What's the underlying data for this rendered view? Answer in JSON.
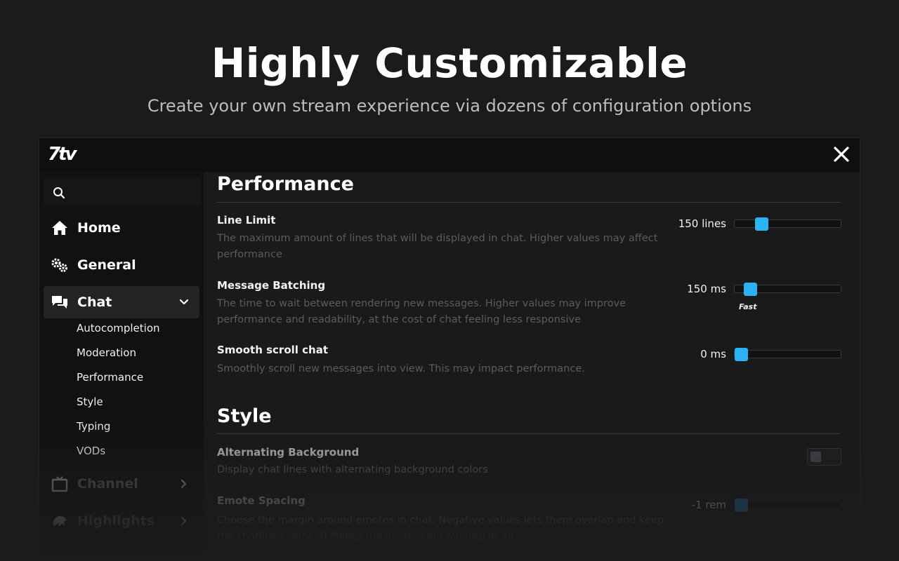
{
  "hero": {
    "title": "Highly Customizable",
    "subtitle": "Create your own stream experience via dozens of configuration options"
  },
  "window": {
    "logo": "7tv",
    "close_icon": "close-icon"
  },
  "sidebar": {
    "search_icon": "search-icon",
    "items": [
      {
        "label": "Home",
        "icon": "home-icon"
      },
      {
        "label": "General",
        "icon": "gears-icon"
      },
      {
        "label": "Chat",
        "icon": "chat-icon",
        "expanded": true
      },
      {
        "label": "Channel",
        "icon": "tv-icon"
      },
      {
        "label": "Highlights",
        "icon": "highlight-icon"
      }
    ],
    "chat_subitems": [
      "Autocompletion",
      "Moderation",
      "Performance",
      "Style",
      "Typing",
      "VODs"
    ]
  },
  "content": {
    "sections": [
      {
        "title": "Performance",
        "options": [
          {
            "name": "Line Limit",
            "description": "The maximum amount of lines that will be displayed in chat. Higher values may affect performance",
            "value": "150 lines",
            "level": 0.22
          },
          {
            "name": "Message Batching",
            "description": "The time to wait between rendering new messages. Higher values may improve performance and readability, at the cost of chat feeling less responsive",
            "value": "150 ms",
            "hint": "Fast",
            "level": 0.1
          },
          {
            "name": "Smooth scroll chat",
            "description": "Smoothly scroll new messages into view. This may impact performance.",
            "value": "0 ms",
            "level": 0.0
          }
        ]
      },
      {
        "title": "Style",
        "options": [
          {
            "name": "Alternating Background",
            "description": "Display chat lines with alternating background colors",
            "toggle": false
          },
          {
            "name": "Emote Spacing",
            "description": "Choose the margin around emotes in chat. Negative values lets them overlap and keep the chatlines inline. 0 Makes the emotes not overlap at all",
            "value": "-1 rem",
            "level": 0.0
          }
        ]
      }
    ]
  },
  "colors": {
    "accent": "#2ab3f0",
    "background": "#1b1b1e",
    "panel": "#1a1a1c"
  }
}
